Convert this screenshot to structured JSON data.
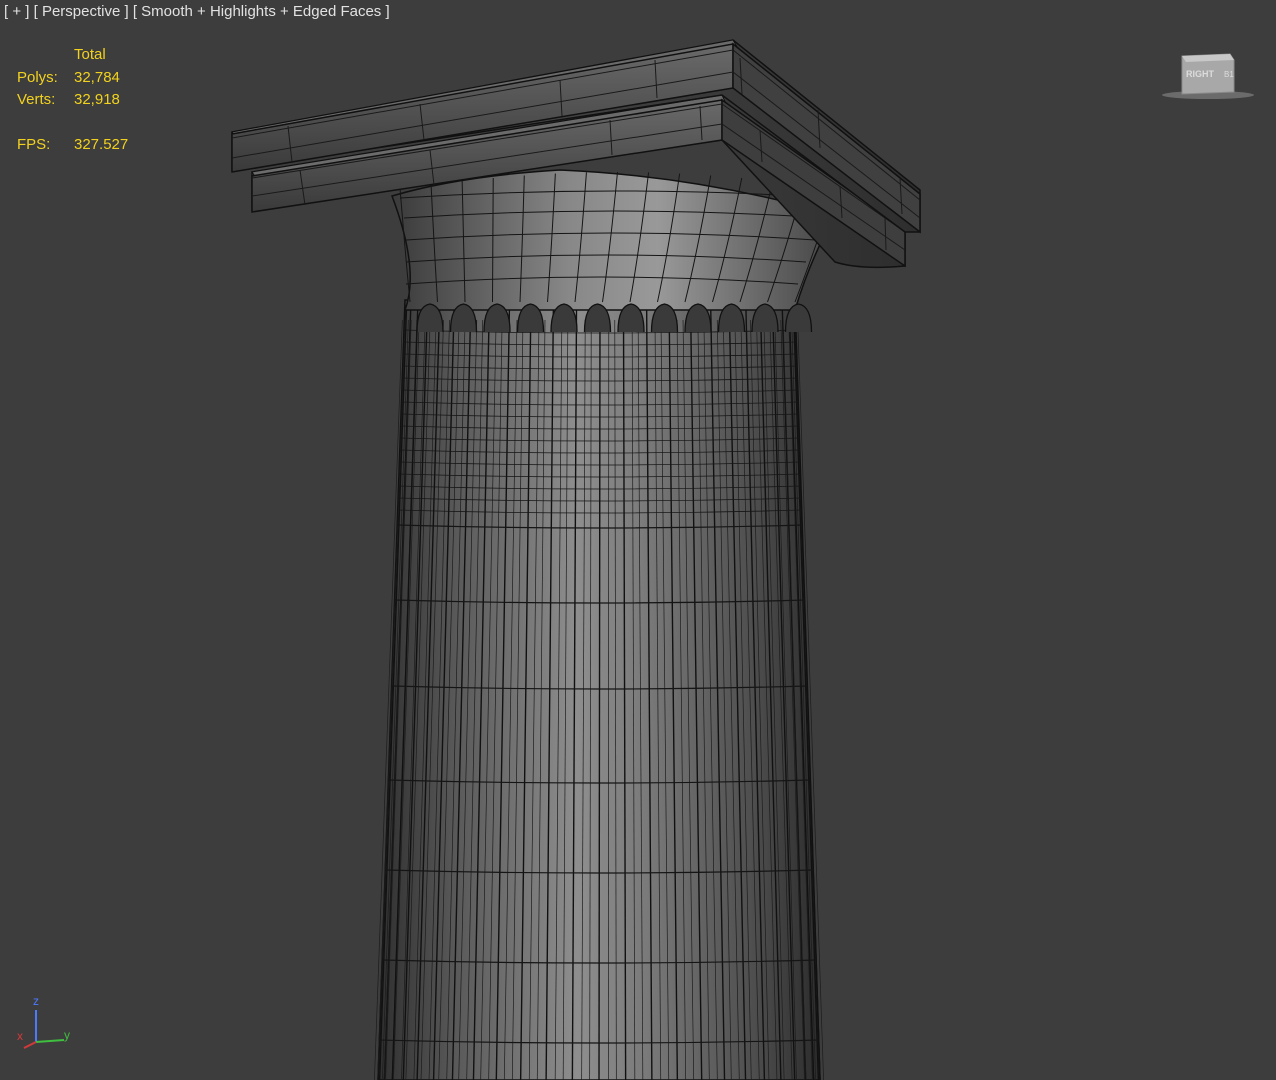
{
  "viewport": {
    "label_plus": "[ + ]",
    "label_view": "[ Perspective ]",
    "label_shading": "[ Smooth + Highlights + Edged Faces ]"
  },
  "stats": {
    "header": "Total",
    "polys_label": "Polys:",
    "polys_value": "32,784",
    "verts_label": "Verts:",
    "verts_value": "32,918",
    "fps_label": "FPS:",
    "fps_value": "327.527"
  },
  "viewcube": {
    "face_label": "RIGHT",
    "icon": "viewcube-icon"
  },
  "gizmo": {
    "z": "z",
    "x": "x",
    "y": "y",
    "icon": "axis-gizmo-icon"
  },
  "colors": {
    "background": "#3d3d3d",
    "stats_text": "#f2d21e",
    "label_text": "#e2e2e2",
    "axis_x": "#d23a3a",
    "axis_y": "#3fbf3f",
    "axis_z": "#4a7bff"
  }
}
